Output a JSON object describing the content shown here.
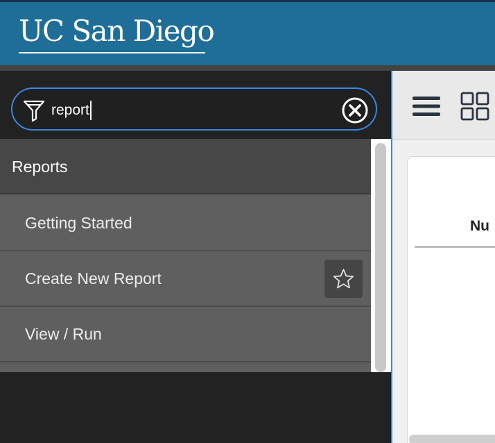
{
  "header": {
    "logo_text": "UC San Diego",
    "background": "#1f6e98"
  },
  "search": {
    "value": "report",
    "filter_icon": "funnel-icon",
    "clear_icon": "clear-circle-x-icon",
    "border_color": "#3a86e0"
  },
  "nav_icons": [
    {
      "name": "archive-box-icon"
    },
    {
      "name": "star-icon"
    },
    {
      "name": "clock-icon"
    }
  ],
  "menu": {
    "section_title": "Reports",
    "items": [
      {
        "label": "Getting Started",
        "favorite_button": false
      },
      {
        "label": "Create New Report",
        "favorite_button": true
      },
      {
        "label": "View / Run",
        "favorite_button": false
      }
    ]
  },
  "main": {
    "toolbar_icons": [
      "hamburger-menu-icon",
      "grid-view-icon"
    ],
    "column_header": "Nu"
  }
}
